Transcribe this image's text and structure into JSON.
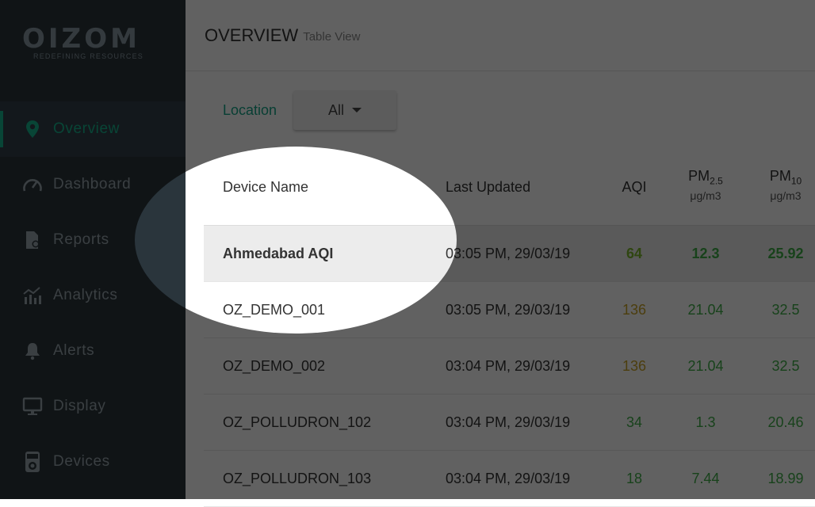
{
  "sidebar": {
    "logo": {
      "word": "OIZOM",
      "tagline": "REDEFINING RESOURCES"
    },
    "items": [
      {
        "label": "Overview",
        "icon": "map-pin-icon",
        "active": true
      },
      {
        "label": "Dashboard",
        "icon": "speedometer-icon"
      },
      {
        "label": "Reports",
        "icon": "report-icon"
      },
      {
        "label": "Analytics",
        "icon": "analytics-icon"
      },
      {
        "label": "Alerts",
        "icon": "bell-icon"
      },
      {
        "label": "Display",
        "icon": "monitor-icon"
      },
      {
        "label": "Devices",
        "icon": "device-icon"
      }
    ]
  },
  "header": {
    "title": "OVERVIEW",
    "subtitle": "Table View"
  },
  "filter": {
    "label": "Location",
    "selected": "All"
  },
  "table": {
    "columns": {
      "name": "Device Name",
      "time": "Last Updated",
      "aqi": "AQI",
      "pm25_main": "PM",
      "pm25_sub": "2.5",
      "pm25_unit": "μg/m3",
      "pm10_main": "PM",
      "pm10_sub": "10",
      "pm10_unit": "μg/m3"
    },
    "rows": [
      {
        "name": "Ahmedabad AQI",
        "time": "03:05 PM, 29/03/19",
        "aqi": "64",
        "pm25": "12.3",
        "pm10": "25.92"
      },
      {
        "name": "OZ_DEMO_001",
        "time": "03:05 PM, 29/03/19",
        "aqi": "136",
        "pm25": "21.04",
        "pm10": "32.5"
      },
      {
        "name": "OZ_DEMO_002",
        "time": "03:04 PM, 29/03/19",
        "aqi": "136",
        "pm25": "21.04",
        "pm10": "32.5"
      },
      {
        "name": "OZ_POLLUDRON_102",
        "time": "03:04 PM, 29/03/19",
        "aqi": "34",
        "pm25": "1.3",
        "pm10": "20.46"
      },
      {
        "name": "OZ_POLLUDRON_103",
        "time": "03:04 PM, 29/03/19",
        "aqi": "18",
        "pm25": "7.44",
        "pm10": "18.99"
      }
    ]
  },
  "colors": {
    "accent": "#17b58e",
    "aqi_good": "#7cb82f",
    "aqi_moderate": "#c9a227",
    "pm_good": "#3fae49"
  }
}
